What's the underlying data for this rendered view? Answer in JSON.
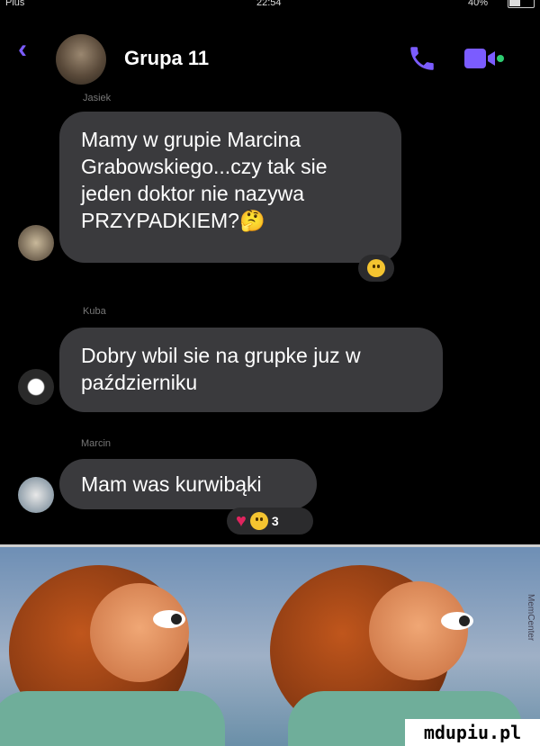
{
  "status_bar": {
    "carrier": "Plus",
    "time": "22:54",
    "battery": "40%"
  },
  "header": {
    "title": "Grupa 11",
    "back_icon": "chevron-left-icon",
    "call_icon": "phone-icon",
    "video_icon": "video-camera-icon"
  },
  "messages": [
    {
      "sender": "Jasiek",
      "text": "Mamy w grupie Marcina Grabowskiego...czy tak sie jeden doktor nie nazywa PRZYPADKIEM?🤔"
    },
    {
      "sender": "Kuba",
      "text": "Dobry wbil sie na grupke juz w październiku"
    },
    {
      "sender": "Marcin",
      "text": "Mam was kurwibąki"
    }
  ],
  "reactions": {
    "message_1": "🤔",
    "message_3_count": "3"
  },
  "meme": {
    "side_credit": "MemCenter",
    "watermark": "mdupiu.pl"
  },
  "colors": {
    "accent": "#7b5cff",
    "bubble": "#3a3a3d",
    "background": "#000000"
  }
}
